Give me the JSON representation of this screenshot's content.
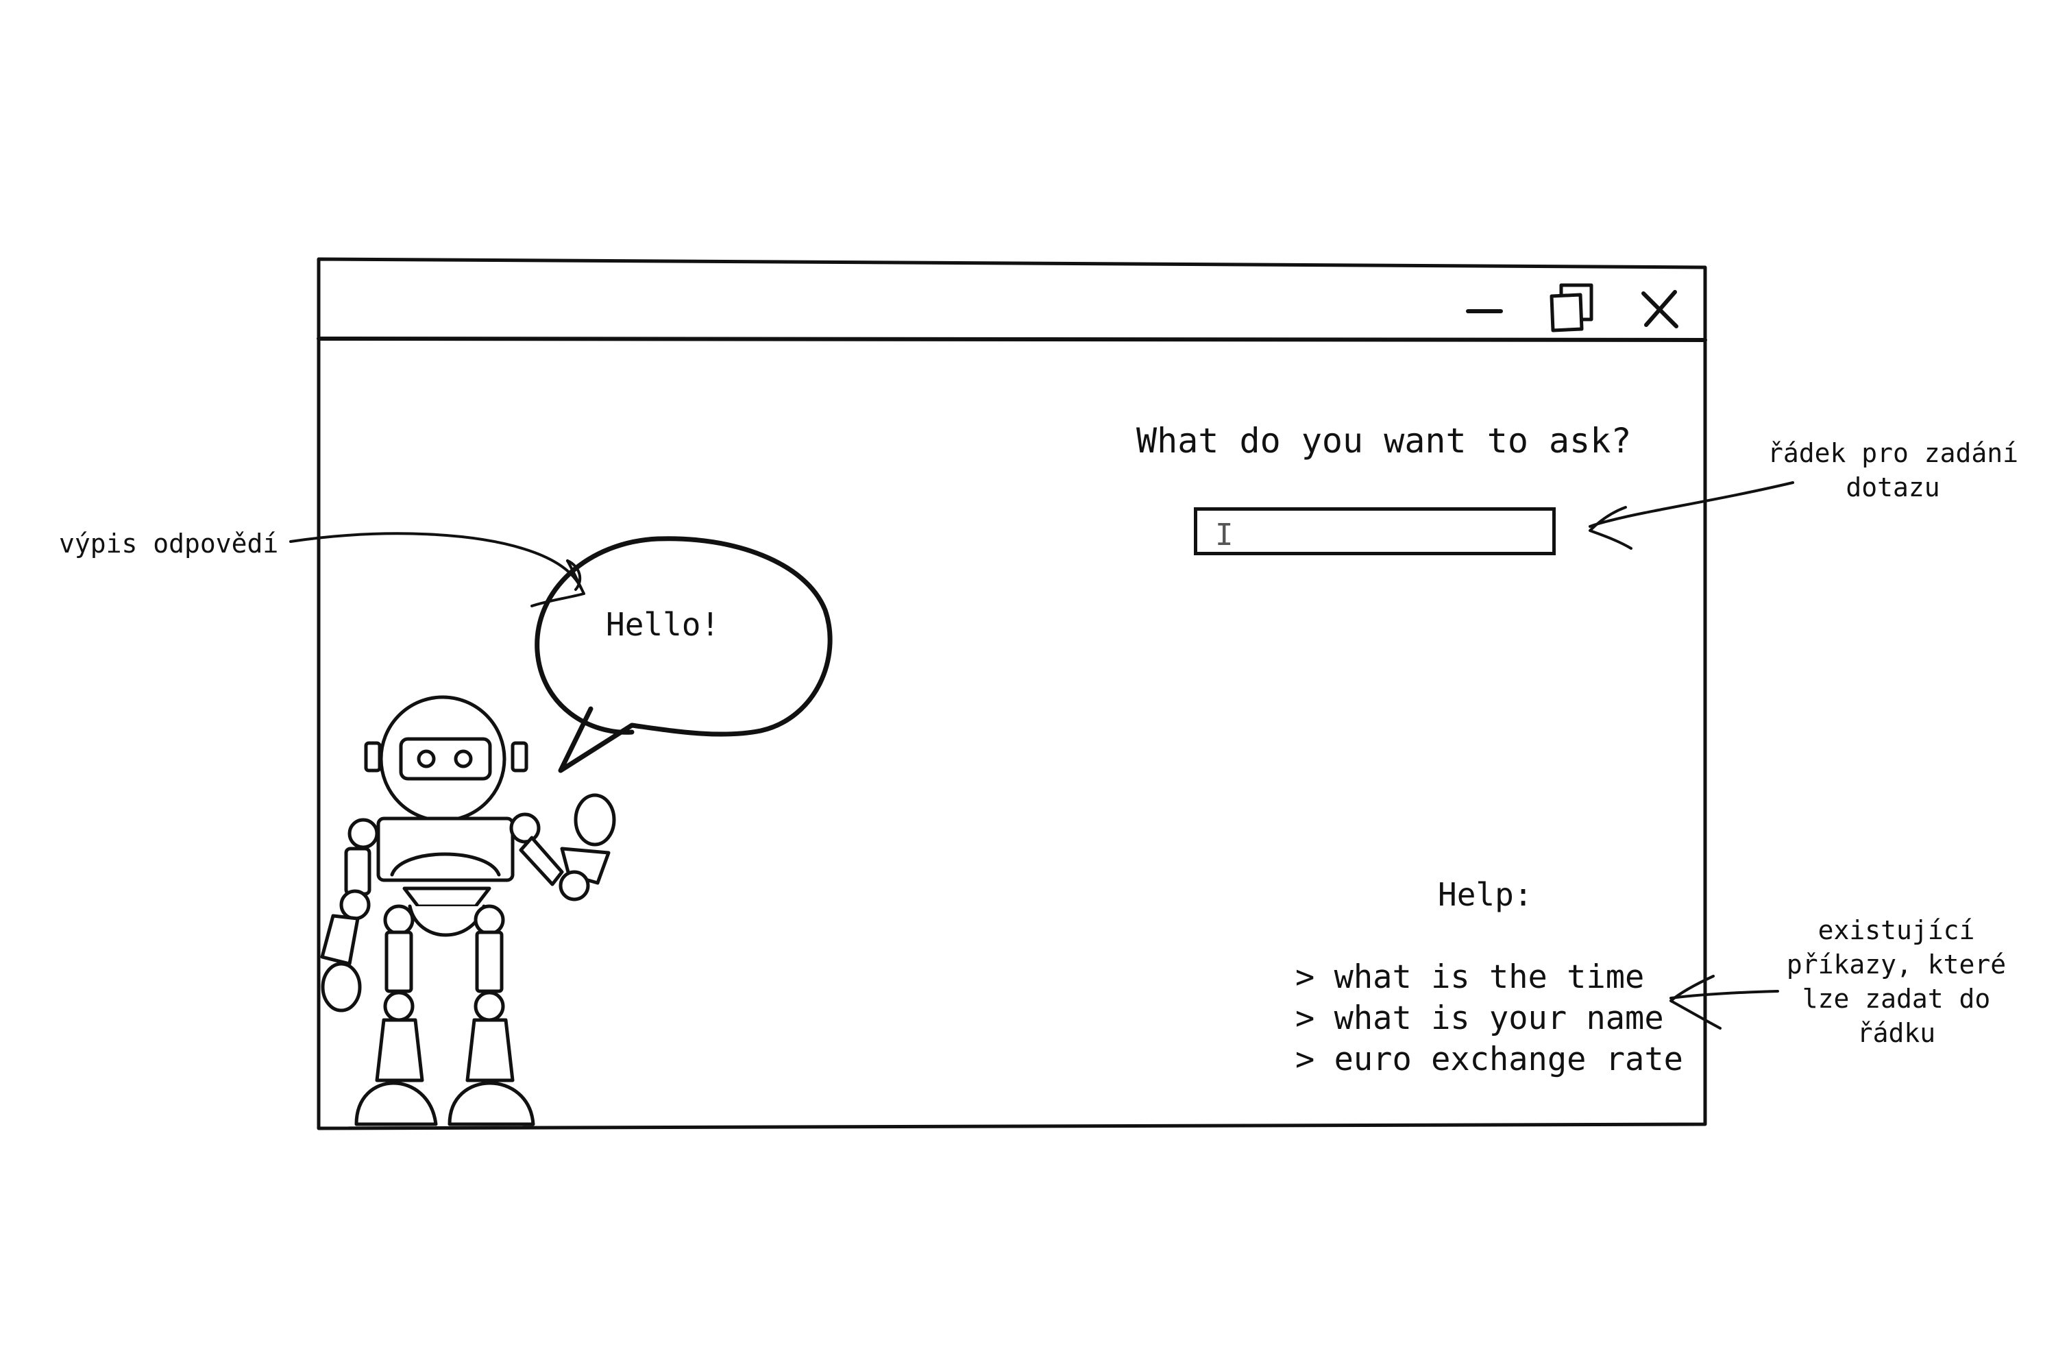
{
  "window": {
    "controls": {
      "minimize_icon": "minimize-icon",
      "maximize_icon": "restore-icon",
      "close_icon": "close-icon"
    },
    "prompt_label": "What do you want to ask?",
    "query_input": {
      "value": "",
      "cursor_icon": "text-cursor-icon"
    },
    "speech_bubble": {
      "text": "Hello!"
    },
    "mascot_icon": "robot-icon",
    "help": {
      "title": "Help:",
      "commands": [
        "> what is the time",
        "> what is your name",
        "> euro exchange rate"
      ]
    }
  },
  "annotations": {
    "output": "výpis odpovědí",
    "input": "řádek pro zadání dotazu",
    "help": "existující příkazy, které lze zadat do řádku"
  },
  "colors": {
    "ink": "#111111",
    "background": "#ffffff"
  }
}
